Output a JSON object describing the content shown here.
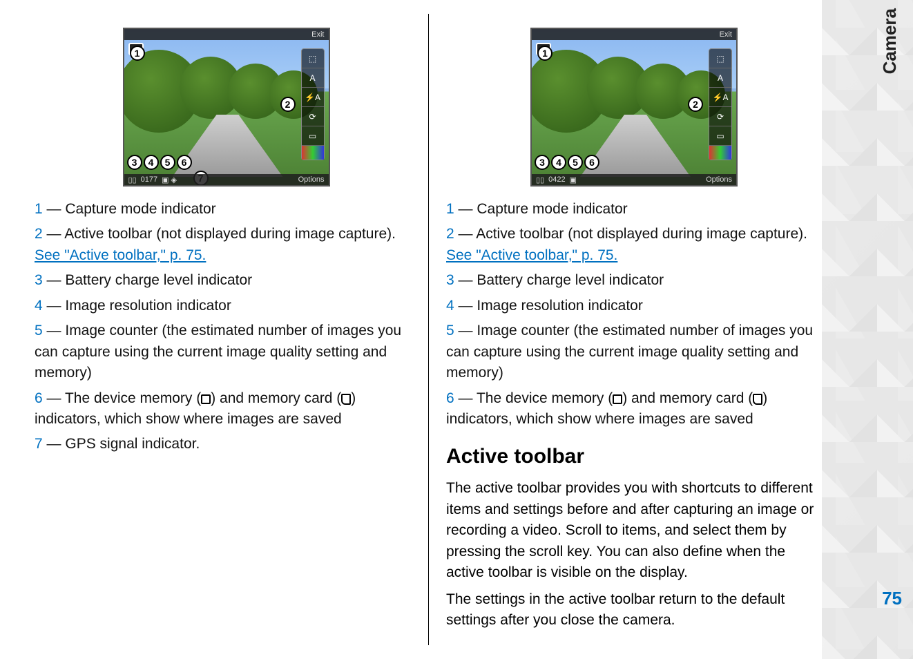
{
  "sidebar": {
    "section": "Camera",
    "page_number": "75"
  },
  "screenshots": {
    "left": {
      "exit": "Exit",
      "options": "Options",
      "counter": "0177",
      "badges": [
        "1",
        "2",
        "3",
        "4",
        "5",
        "6",
        "7"
      ],
      "toolbar": [
        "⬚",
        "A",
        "⚡A",
        "⟳",
        "▭",
        ""
      ]
    },
    "right": {
      "exit": "Exit",
      "options": "Options",
      "counter": "0422",
      "badges": [
        "1",
        "2",
        "3",
        "4",
        "5",
        "6"
      ],
      "toolbar": [
        "⬚",
        "A",
        "⚡A",
        "⟳",
        "▭",
        ""
      ]
    }
  },
  "left_legend": [
    {
      "n": "1",
      "text": " — Capture mode indicator"
    },
    {
      "n": "2",
      "text": " — Active toolbar (not displayed during image capture). ",
      "link": "See \"Active toolbar,\" p. 75."
    },
    {
      "n": "3",
      "text": " — Battery charge level indicator"
    },
    {
      "n": "4",
      "text": " — Image resolution indicator"
    },
    {
      "n": "5",
      "text": " — Image counter (the estimated number of images you can capture using the current image quality setting and memory)"
    },
    {
      "n": "6",
      "pre": " — The device memory (",
      "mid": ") and memory card (",
      "post": ") indicators, which show where images are saved"
    },
    {
      "n": "7",
      "text": " — GPS signal indicator."
    }
  ],
  "right_legend": [
    {
      "n": "1",
      "text": " — Capture mode indicator"
    },
    {
      "n": "2",
      "text": " — Active toolbar (not displayed during image capture). ",
      "link": "See \"Active toolbar,\" p. 75."
    },
    {
      "n": "3",
      "text": " — Battery charge level indicator"
    },
    {
      "n": "4",
      "text": " — Image resolution indicator"
    },
    {
      "n": "5",
      "text": " — Image counter (the estimated number of images you can capture using the current image quality setting and memory)"
    },
    {
      "n": "6",
      "pre": " — The device memory (",
      "mid": ") and memory card (",
      "post": ") indicators, which show where images are saved"
    }
  ],
  "section": {
    "heading": "Active toolbar",
    "p1": "The active toolbar provides you with shortcuts to different items and settings before and after capturing an image or recording a video. Scroll to items, and select them by pressing the scroll key. You can also define when the active toolbar is visible on the display.",
    "p2": "The settings in the active toolbar return to the default settings after you close the camera."
  }
}
